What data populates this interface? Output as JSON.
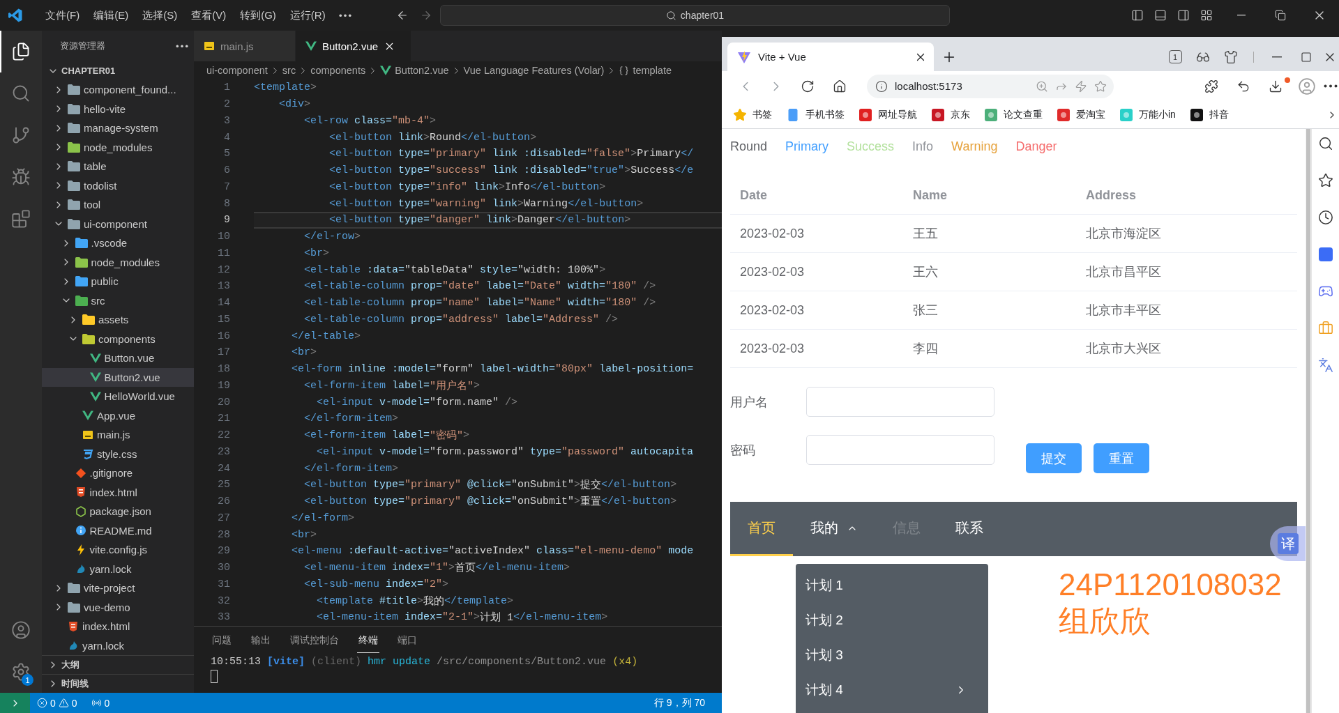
{
  "title_bar": {
    "menus": [
      "文件(F)",
      "编辑(E)",
      "选择(S)",
      "查看(V)",
      "转到(G)",
      "运行(R)"
    ],
    "search": "chapter01"
  },
  "activity_bar": {
    "items": [
      {
        "kind": "explorer",
        "selected": true
      },
      {
        "kind": "search",
        "selected": false
      },
      {
        "kind": "source-control",
        "selected": false
      },
      {
        "kind": "run",
        "selected": false
      },
      {
        "kind": "extensions",
        "selected": false
      }
    ],
    "settings_badge": "1"
  },
  "explorer": {
    "title": "资源管理器",
    "root": {
      "label": "CHAPTER01",
      "expanded": true,
      "children": [
        {
          "label": "component_found...",
          "kind": "folder",
          "expanded": false,
          "selected": false
        },
        {
          "label": "hello-vite",
          "kind": "folder",
          "expanded": false,
          "selected": false
        },
        {
          "label": "manage-system",
          "kind": "folder",
          "expanded": false,
          "selected": false
        },
        {
          "label": "node_modules",
          "kind": "folder-node",
          "expanded": false,
          "selected": false
        },
        {
          "label": "table",
          "kind": "folder",
          "expanded": false,
          "selected": false
        },
        {
          "label": "todolist",
          "kind": "folder",
          "expanded": false,
          "selected": false
        },
        {
          "label": "tool",
          "kind": "folder",
          "expanded": false,
          "selected": false
        },
        {
          "label": "ui-component",
          "kind": "folder",
          "expanded": true,
          "selected": false,
          "children": [
            {
              "label": ".vscode",
              "kind": "folder-vscode",
              "expanded": false,
              "selected": false
            },
            {
              "label": "node_modules",
              "kind": "folder-node",
              "expanded": false,
              "selected": false
            },
            {
              "label": "public",
              "kind": "folder-public",
              "expanded": false,
              "selected": false
            },
            {
              "label": "src",
              "kind": "folder-src",
              "expanded": true,
              "selected": false,
              "children": [
                {
                  "label": "assets",
                  "kind": "folder-assets",
                  "expanded": false,
                  "selected": false
                },
                {
                  "label": "components",
                  "kind": "folder-components",
                  "expanded": true,
                  "selected": false,
                  "children": [
                    {
                      "label": "Button.vue",
                      "kind": "vue",
                      "selected": false
                    },
                    {
                      "label": "Button2.vue",
                      "kind": "vue",
                      "selected": true
                    },
                    {
                      "label": "HelloWorld.vue",
                      "kind": "vue",
                      "selected": false
                    }
                  ]
                },
                {
                  "label": "App.vue",
                  "kind": "vue",
                  "selected": false
                },
                {
                  "label": "main.js",
                  "kind": "js",
                  "selected": false
                },
                {
                  "label": "style.css",
                  "kind": "css",
                  "selected": false
                }
              ]
            },
            {
              "label": ".gitignore",
              "kind": "git",
              "selected": false
            },
            {
              "label": "index.html",
              "kind": "html",
              "selected": false
            },
            {
              "label": "package.json",
              "kind": "json",
              "selected": false
            },
            {
              "label": "README.md",
              "kind": "info",
              "selected": false
            },
            {
              "label": "vite.config.js",
              "kind": "bolt",
              "selected": false
            },
            {
              "label": "yarn.lock",
              "kind": "yarn",
              "selected": false
            }
          ]
        },
        {
          "label": "vite-project",
          "kind": "folder",
          "expanded": false,
          "selected": false
        },
        {
          "label": "vue-demo",
          "kind": "folder",
          "expanded": false,
          "selected": false
        },
        {
          "label": "index.html",
          "kind": "html",
          "selected": false
        },
        {
          "label": "yarn.lock",
          "kind": "yarn",
          "selected": false
        }
      ]
    },
    "sections": [
      {
        "label": "大纲",
        "expanded": false
      },
      {
        "label": "时间线",
        "expanded": false
      }
    ]
  },
  "editor": {
    "tabs": [
      {
        "label": "main.js",
        "kind": "js",
        "selected": false
      },
      {
        "label": "Button2.vue",
        "kind": "vue",
        "selected": true
      }
    ],
    "breadcrumb": [
      {
        "label": "ui-component",
        "kind": "plain"
      },
      {
        "label": "src",
        "kind": "plain"
      },
      {
        "label": "components",
        "kind": "plain"
      },
      {
        "label": "Button2.vue",
        "kind": "vue"
      },
      {
        "label": "Vue Language Features (Volar)",
        "kind": "plain"
      },
      {
        "label": "template",
        "kind": "braces"
      }
    ],
    "lines": [
      {
        "number": "1",
        "current": false,
        "tokens": [
          {
            "kind": "tag",
            "text": "<template"
          },
          {
            "kind": "punct",
            "text": ">"
          }
        ]
      },
      {
        "number": "2",
        "current": false,
        "tokens": [
          {
            "kind": "tag",
            "text": "    <div"
          },
          {
            "kind": "punct",
            "text": ">"
          }
        ]
      },
      {
        "number": "3",
        "current": false,
        "tokens": [
          {
            "kind": "tag",
            "text": "        <el-row"
          },
          {
            "kind": "attr",
            "text": " class="
          },
          {
            "kind": "string",
            "text": "\"mb-4\""
          },
          {
            "kind": "punct",
            "text": ">"
          }
        ]
      },
      {
        "number": "4",
        "current": false,
        "tokens": [
          {
            "kind": "tag",
            "text": "            <el-button"
          },
          {
            "kind": "attr",
            "text": " link"
          },
          {
            "kind": "punct",
            "text": ">"
          },
          {
            "kind": "text",
            "text": "Round"
          },
          {
            "kind": "tag",
            "text": "</el-button"
          },
          {
            "kind": "punct",
            "text": ">"
          }
        ]
      },
      {
        "number": "5",
        "current": false,
        "tokens": [
          {
            "kind": "tag",
            "text": "            <el-button"
          },
          {
            "kind": "attr",
            "text": " type="
          },
          {
            "kind": "string",
            "text": "\"primary\""
          },
          {
            "kind": "attr",
            "text": " link :disabled="
          },
          {
            "kind": "string",
            "text": "\"false\""
          },
          {
            "kind": "punct",
            "text": ">"
          },
          {
            "kind": "text",
            "text": "Primary"
          },
          {
            "kind": "tag",
            "text": "</"
          }
        ]
      },
      {
        "number": "6",
        "current": false,
        "tokens": [
          {
            "kind": "tag",
            "text": "            <el-button"
          },
          {
            "kind": "attr",
            "text": " type="
          },
          {
            "kind": "string",
            "text": "\"success\""
          },
          {
            "kind": "attr",
            "text": " link :disabled="
          },
          {
            "kind": "keyword",
            "text": "\"true\""
          },
          {
            "kind": "punct",
            "text": ">"
          },
          {
            "kind": "text",
            "text": "Success"
          },
          {
            "kind": "tag",
            "text": "</e"
          }
        ]
      },
      {
        "number": "7",
        "current": false,
        "tokens": [
          {
            "kind": "tag",
            "text": "            <el-button"
          },
          {
            "kind": "attr",
            "text": " type="
          },
          {
            "kind": "string",
            "text": "\"info\""
          },
          {
            "kind": "attr",
            "text": " link"
          },
          {
            "kind": "punct",
            "text": ">"
          },
          {
            "kind": "text",
            "text": "Info"
          },
          {
            "kind": "tag",
            "text": "</el-button"
          },
          {
            "kind": "punct",
            "text": ">"
          }
        ]
      },
      {
        "number": "8",
        "current": false,
        "tokens": [
          {
            "kind": "tag",
            "text": "            <el-button"
          },
          {
            "kind": "attr",
            "text": " type="
          },
          {
            "kind": "string",
            "text": "\"warning\""
          },
          {
            "kind": "attr",
            "text": " link"
          },
          {
            "kind": "punct",
            "text": ">"
          },
          {
            "kind": "text",
            "text": "Warning"
          },
          {
            "kind": "tag",
            "text": "</el-button"
          },
          {
            "kind": "punct",
            "text": ">"
          }
        ]
      },
      {
        "number": "9",
        "current": true,
        "tokens": [
          {
            "kind": "tag",
            "text": "            <el-button"
          },
          {
            "kind": "attr",
            "text": " type="
          },
          {
            "kind": "string",
            "text": "\"danger\""
          },
          {
            "kind": "attr",
            "text": " link"
          },
          {
            "kind": "punct",
            "text": ">"
          },
          {
            "kind": "text",
            "text": "Danger"
          },
          {
            "kind": "tag",
            "text": "</el-button"
          },
          {
            "kind": "punct",
            "text": ">"
          }
        ]
      },
      {
        "number": "10",
        "current": false,
        "tokens": [
          {
            "kind": "tag",
            "text": "        </el-row"
          },
          {
            "kind": "punct",
            "text": ">"
          }
        ]
      },
      {
        "number": "11",
        "current": false,
        "tokens": [
          {
            "kind": "tag",
            "text": "        <br"
          },
          {
            "kind": "punct",
            "text": ">"
          }
        ]
      },
      {
        "number": "12",
        "current": false,
        "tokens": [
          {
            "kind": "tag",
            "text": "        <el-table"
          },
          {
            "kind": "attr",
            "text": " :data="
          },
          {
            "kind": "text",
            "text": "\"tableData\""
          },
          {
            "kind": "attr",
            "text": " style="
          },
          {
            "kind": "text",
            "text": "\"width: 100%\""
          },
          {
            "kind": "punct",
            "text": ">"
          }
        ]
      },
      {
        "number": "13",
        "current": false,
        "tokens": [
          {
            "kind": "tag",
            "text": "        <el-table-column"
          },
          {
            "kind": "attr",
            "text": " prop="
          },
          {
            "kind": "string",
            "text": "\"date\""
          },
          {
            "kind": "attr",
            "text": " label="
          },
          {
            "kind": "string",
            "text": "\"Date\""
          },
          {
            "kind": "attr",
            "text": " width="
          },
          {
            "kind": "string",
            "text": "\"180\""
          },
          {
            "kind": "punct",
            "text": " />"
          }
        ]
      },
      {
        "number": "14",
        "current": false,
        "tokens": [
          {
            "kind": "tag",
            "text": "        <el-table-column"
          },
          {
            "kind": "attr",
            "text": " prop="
          },
          {
            "kind": "string",
            "text": "\"name\""
          },
          {
            "kind": "attr",
            "text": " label="
          },
          {
            "kind": "string",
            "text": "\"Name\""
          },
          {
            "kind": "attr",
            "text": " width="
          },
          {
            "kind": "string",
            "text": "\"180\""
          },
          {
            "kind": "punct",
            "text": " />"
          }
        ]
      },
      {
        "number": "15",
        "current": false,
        "tokens": [
          {
            "kind": "tag",
            "text": "        <el-table-column"
          },
          {
            "kind": "attr",
            "text": " prop="
          },
          {
            "kind": "string",
            "text": "\"address\""
          },
          {
            "kind": "attr",
            "text": " label="
          },
          {
            "kind": "string",
            "text": "\"Address\""
          },
          {
            "kind": "punct",
            "text": " />"
          }
        ]
      },
      {
        "number": "16",
        "current": false,
        "tokens": [
          {
            "kind": "tag",
            "text": "      </el-table"
          },
          {
            "kind": "punct",
            "text": ">"
          }
        ]
      },
      {
        "number": "17",
        "current": false,
        "tokens": [
          {
            "kind": "tag",
            "text": "      <br"
          },
          {
            "kind": "punct",
            "text": ">"
          }
        ]
      },
      {
        "number": "18",
        "current": false,
        "tokens": [
          {
            "kind": "tag",
            "text": "      <el-form"
          },
          {
            "kind": "attr",
            "text": " inline :model="
          },
          {
            "kind": "text",
            "text": "\"form\""
          },
          {
            "kind": "attr",
            "text": " label-width="
          },
          {
            "kind": "string",
            "text": "\"80px\""
          },
          {
            "kind": "attr",
            "text": " label-position="
          }
        ]
      },
      {
        "number": "19",
        "current": false,
        "tokens": [
          {
            "kind": "tag",
            "text": "        <el-form-item"
          },
          {
            "kind": "attr",
            "text": " label="
          },
          {
            "kind": "string",
            "text": "\"用户名\""
          },
          {
            "kind": "punct",
            "text": ">"
          }
        ]
      },
      {
        "number": "20",
        "current": false,
        "tokens": [
          {
            "kind": "tag",
            "text": "          <el-input"
          },
          {
            "kind": "attr",
            "text": " v-model="
          },
          {
            "kind": "text",
            "text": "\"form.name\""
          },
          {
            "kind": "punct",
            "text": " />"
          }
        ]
      },
      {
        "number": "21",
        "current": false,
        "tokens": [
          {
            "kind": "tag",
            "text": "        </el-form-item"
          },
          {
            "kind": "punct",
            "text": ">"
          }
        ]
      },
      {
        "number": "22",
        "current": false,
        "tokens": [
          {
            "kind": "tag",
            "text": "        <el-form-item"
          },
          {
            "kind": "attr",
            "text": " label="
          },
          {
            "kind": "string",
            "text": "\"密码\""
          },
          {
            "kind": "punct",
            "text": ">"
          }
        ]
      },
      {
        "number": "23",
        "current": false,
        "tokens": [
          {
            "kind": "tag",
            "text": "          <el-input"
          },
          {
            "kind": "attr",
            "text": " v-model="
          },
          {
            "kind": "text",
            "text": "\"form.password\""
          },
          {
            "kind": "attr",
            "text": " type="
          },
          {
            "kind": "string",
            "text": "\"password\""
          },
          {
            "kind": "attr",
            "text": " autocapita"
          }
        ]
      },
      {
        "number": "24",
        "current": false,
        "tokens": [
          {
            "kind": "tag",
            "text": "        </el-form-item"
          },
          {
            "kind": "punct",
            "text": ">"
          }
        ]
      },
      {
        "number": "25",
        "current": false,
        "tokens": [
          {
            "kind": "tag",
            "text": "        <el-button"
          },
          {
            "kind": "attr",
            "text": " type="
          },
          {
            "kind": "string",
            "text": "\"primary\""
          },
          {
            "kind": "attr",
            "text": " @click="
          },
          {
            "kind": "text",
            "text": "\"onSubmit\""
          },
          {
            "kind": "punct",
            "text": ">"
          },
          {
            "kind": "text",
            "text": "提交"
          },
          {
            "kind": "tag",
            "text": "</el-button"
          },
          {
            "kind": "punct",
            "text": ">"
          }
        ]
      },
      {
        "number": "26",
        "current": false,
        "tokens": [
          {
            "kind": "tag",
            "text": "        <el-button"
          },
          {
            "kind": "attr",
            "text": " type="
          },
          {
            "kind": "string",
            "text": "\"primary\""
          },
          {
            "kind": "attr",
            "text": " @click="
          },
          {
            "kind": "text",
            "text": "\"onSubmit\""
          },
          {
            "kind": "punct",
            "text": ">"
          },
          {
            "kind": "text",
            "text": "重置"
          },
          {
            "kind": "tag",
            "text": "</el-button"
          },
          {
            "kind": "punct",
            "text": ">"
          }
        ]
      },
      {
        "number": "27",
        "current": false,
        "tokens": [
          {
            "kind": "tag",
            "text": "      </el-form"
          },
          {
            "kind": "punct",
            "text": ">"
          }
        ]
      },
      {
        "number": "28",
        "current": false,
        "tokens": [
          {
            "kind": "tag",
            "text": "      <br"
          },
          {
            "kind": "punct",
            "text": ">"
          }
        ]
      },
      {
        "number": "29",
        "current": false,
        "tokens": [
          {
            "kind": "tag",
            "text": "      <el-menu"
          },
          {
            "kind": "attr",
            "text": " :default-active="
          },
          {
            "kind": "text",
            "text": "\"activeIndex\""
          },
          {
            "kind": "attr",
            "text": " class="
          },
          {
            "kind": "string",
            "text": "\"el-menu-demo\""
          },
          {
            "kind": "attr",
            "text": " mode"
          }
        ]
      },
      {
        "number": "30",
        "current": false,
        "tokens": [
          {
            "kind": "tag",
            "text": "        <el-menu-item"
          },
          {
            "kind": "attr",
            "text": " index="
          },
          {
            "kind": "string",
            "text": "\"1\""
          },
          {
            "kind": "punct",
            "text": ">"
          },
          {
            "kind": "text",
            "text": "首页"
          },
          {
            "kind": "tag",
            "text": "</el-menu-item"
          },
          {
            "kind": "punct",
            "text": ">"
          }
        ]
      },
      {
        "number": "31",
        "current": false,
        "tokens": [
          {
            "kind": "tag",
            "text": "        <el-sub-menu"
          },
          {
            "kind": "attr",
            "text": " index="
          },
          {
            "kind": "string",
            "text": "\"2\""
          },
          {
            "kind": "punct",
            "text": ">"
          }
        ]
      },
      {
        "number": "32",
        "current": false,
        "tokens": [
          {
            "kind": "tag",
            "text": "          <template"
          },
          {
            "kind": "attr",
            "text": " #title"
          },
          {
            "kind": "punct",
            "text": ">"
          },
          {
            "kind": "text",
            "text": "我的"
          },
          {
            "kind": "tag",
            "text": "</template"
          },
          {
            "kind": "punct",
            "text": ">"
          }
        ]
      },
      {
        "number": "33",
        "current": false,
        "tokens": [
          {
            "kind": "tag",
            "text": "          <el-menu-item"
          },
          {
            "kind": "attr",
            "text": " index="
          },
          {
            "kind": "string",
            "text": "\"2-1\""
          },
          {
            "kind": "punct",
            "text": ">"
          },
          {
            "kind": "text",
            "text": "计划 1"
          },
          {
            "kind": "tag",
            "text": "</el-menu-item"
          },
          {
            "kind": "punct",
            "text": ">"
          }
        ]
      }
    ]
  },
  "panel": {
    "tabs": [
      {
        "label": "问题",
        "selected": false
      },
      {
        "label": "输出",
        "selected": false
      },
      {
        "label": "调试控制台",
        "selected": false
      },
      {
        "label": "终端",
        "selected": true
      },
      {
        "label": "端口",
        "selected": false
      }
    ],
    "terminal": [
      {
        "kind": "time",
        "text": "10:55:13"
      },
      {
        "kind": "source",
        "text": "[vite]"
      },
      {
        "kind": "dim",
        "text": "(client)"
      },
      {
        "kind": "action",
        "text": "hmr update"
      },
      {
        "kind": "path",
        "text": "/src/components/Button2.vue"
      },
      {
        "kind": "count",
        "text": "(x4)"
      }
    ]
  },
  "status_bar": {
    "errors": "0",
    "warnings": "0",
    "ports": "0",
    "position": "行 9，列 70"
  },
  "browser": {
    "tabs": [
      {
        "title": "Vite + Vue",
        "selected": true
      }
    ],
    "tab_count": "1",
    "url": "localhost:5173",
    "bookmarks": [
      {
        "label": "书签",
        "kind": "star"
      },
      {
        "label": "手机书签",
        "kind": "phone"
      },
      {
        "label": "网址导航",
        "kind": "nav"
      },
      {
        "label": "京东",
        "kind": "jd"
      },
      {
        "label": "论文查重",
        "kind": "pp"
      },
      {
        "label": "爱淘宝",
        "kind": "taobao"
      },
      {
        "label": "万能小in",
        "kind": "robot"
      },
      {
        "label": "抖音",
        "kind": "douyin"
      }
    ],
    "page": {
      "link_buttons": [
        {
          "label": "Round",
          "kind": "default",
          "disabled": false
        },
        {
          "label": "Primary",
          "kind": "primary",
          "disabled": false
        },
        {
          "label": "Success",
          "kind": "success",
          "disabled": true
        },
        {
          "label": "Info",
          "kind": "info",
          "disabled": false
        },
        {
          "label": "Warning",
          "kind": "warning",
          "disabled": false
        },
        {
          "label": "Danger",
          "kind": "danger",
          "disabled": false
        }
      ],
      "table": {
        "columns": [
          "Date",
          "Name",
          "Address"
        ],
        "rows": [
          [
            "2023-02-03",
            "王五",
            "北京市海淀区"
          ],
          [
            "2023-02-03",
            "王六",
            "北京市昌平区"
          ],
          [
            "2023-02-03",
            "张三",
            "北京市丰平区"
          ],
          [
            "2023-02-03",
            "李四",
            "北京市大兴区"
          ]
        ]
      },
      "form": {
        "fields": [
          {
            "label": "用户名"
          },
          {
            "label": "密码"
          }
        ],
        "buttons": [
          "提交",
          "重置"
        ]
      },
      "menu": {
        "items": [
          {
            "label": "首页",
            "kind": "item",
            "selected": true,
            "disabled": false
          },
          {
            "label": "我的",
            "kind": "submenu",
            "selected": false,
            "disabled": false,
            "expanded": true
          },
          {
            "label": "信息",
            "kind": "item",
            "selected": false,
            "disabled": true
          },
          {
            "label": "联系",
            "kind": "item",
            "selected": false,
            "disabled": false
          }
        ],
        "popup": [
          {
            "label": "计划 1",
            "kind": "item"
          },
          {
            "label": "计划 2",
            "kind": "item"
          },
          {
            "label": "计划 3",
            "kind": "item"
          },
          {
            "label": "计划 4",
            "kind": "submenu"
          }
        ]
      },
      "student": {
        "id": "24P1120108032",
        "name": "组欣欣"
      },
      "translate_button": "译"
    }
  }
}
